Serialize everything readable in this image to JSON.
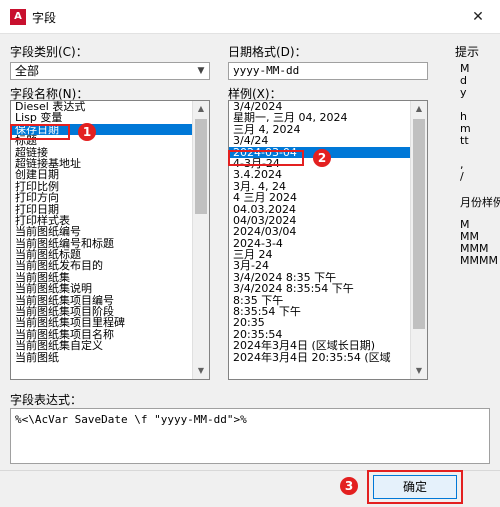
{
  "window": {
    "title": "字段",
    "close_glyph": "✕",
    "app_icon_letter": "A"
  },
  "category": {
    "label": "字段类别(C)：",
    "value": "全部"
  },
  "fields": {
    "label": "字段名称(N)：",
    "items": [
      "Diesel 表达式",
      "Lisp 变量",
      "保存日期",
      "标题",
      "超链接",
      "超链接基地址",
      "创建日期",
      "打印比例",
      "打印方向",
      "打印日期",
      "打印样式表",
      "当前图纸编号",
      "当前图纸编号和标题",
      "当前图纸标题",
      "当前图纸发布目的",
      "当前图纸集",
      "当前图纸集说明",
      "当前图纸集项目编号",
      "当前图纸集项目阶段",
      "当前图纸集项目里程碑",
      "当前图纸集项目名称",
      "当前图纸集自定义",
      "当前图纸"
    ],
    "selected_index": 2
  },
  "format": {
    "label": "日期格式(D)：",
    "value": "yyyy-MM-dd"
  },
  "examples": {
    "label": "样例(X)：",
    "items": [
      "3/4/2024",
      "星期一, 三月 04, 2024",
      "三月 4, 2024",
      "3/4/24",
      "2024-03-04",
      "4-3月-24",
      "3.4.2024",
      "3月. 4, 24",
      "4 三月 2024",
      "04.03.2024",
      "04/03/2024",
      "2024/03/04",
      "2024-3-4",
      "三月 24",
      "3月-24",
      "3/4/2024 8:35 下午",
      "3/4/2024 8:35:54 下午",
      "8:35 下午",
      "8:35:54 下午",
      "20:35",
      "20:35:54",
      "2024年3月4日 (区域长日期)",
      "2024年3月4日 20:35:54 (区域"
    ],
    "selected_index": 4
  },
  "hints": {
    "label": "提示",
    "rows": [
      "M",
      "d",
      "y",
      "",
      "h",
      "m",
      "tt",
      "",
      ",",
      "/",
      "",
      "月份样例",
      "",
      "M",
      "MM",
      "MMM",
      "MMMM"
    ]
  },
  "expression": {
    "label": "字段表达式：",
    "value": "%<\\AcVar SaveDate \\f \"yyyy-MM-dd\">%"
  },
  "ok_button": {
    "label": "确定"
  },
  "annotations": {
    "badge_1": "1",
    "badge_2": "2",
    "badge_3": "3",
    "accent_color": "#e32020"
  }
}
